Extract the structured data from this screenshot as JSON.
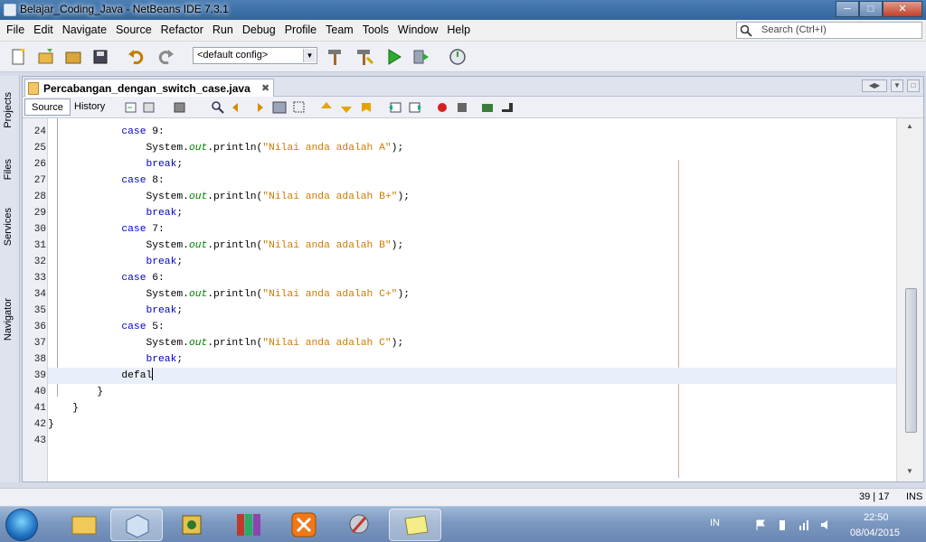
{
  "window": {
    "title": "Belajar_Coding_Java - NetBeans IDE 7.3.1",
    "min_label": "─",
    "max_label": "□",
    "close_label": "✕"
  },
  "menu": [
    "File",
    "Edit",
    "Navigate",
    "Source",
    "Refactor",
    "Run",
    "Debug",
    "Profile",
    "Team",
    "Tools",
    "Window",
    "Help"
  ],
  "search": {
    "placeholder": "Search (Ctrl+I)"
  },
  "toolbar": {
    "config": "<default config>"
  },
  "dock": {
    "tabs": [
      "Projects",
      "Files",
      "Services",
      "Navigator"
    ]
  },
  "editor": {
    "file_tab": "Percabangan_dengan_switch_case.java",
    "close_glyph": "✖",
    "source_label": "Source",
    "history_label": "History",
    "lines": [
      {
        "n": "24",
        "parts": [
          {
            "t": "            "
          },
          {
            "t": "case",
            "c": "kw"
          },
          {
            "t": " 9:"
          }
        ]
      },
      {
        "n": "25",
        "parts": [
          {
            "t": "                System."
          },
          {
            "t": "out",
            "c": "fld"
          },
          {
            "t": ".println("
          },
          {
            "t": "\"Nilai anda adalah A\"",
            "c": "str"
          },
          {
            "t": ");"
          }
        ]
      },
      {
        "n": "26",
        "parts": [
          {
            "t": "                "
          },
          {
            "t": "break",
            "c": "kw"
          },
          {
            "t": ";"
          }
        ]
      },
      {
        "n": "27",
        "parts": [
          {
            "t": "            "
          },
          {
            "t": "case",
            "c": "kw"
          },
          {
            "t": " 8:"
          }
        ]
      },
      {
        "n": "28",
        "parts": [
          {
            "t": "                System."
          },
          {
            "t": "out",
            "c": "fld"
          },
          {
            "t": ".println("
          },
          {
            "t": "\"Nilai anda adalah B+\"",
            "c": "str"
          },
          {
            "t": ");"
          }
        ]
      },
      {
        "n": "29",
        "parts": [
          {
            "t": "                "
          },
          {
            "t": "break",
            "c": "kw"
          },
          {
            "t": ";"
          }
        ]
      },
      {
        "n": "30",
        "parts": [
          {
            "t": "            "
          },
          {
            "t": "case",
            "c": "kw"
          },
          {
            "t": " 7:"
          }
        ]
      },
      {
        "n": "31",
        "parts": [
          {
            "t": "                System."
          },
          {
            "t": "out",
            "c": "fld"
          },
          {
            "t": ".println("
          },
          {
            "t": "\"Nilai anda adalah B\"",
            "c": "str"
          },
          {
            "t": ");"
          }
        ]
      },
      {
        "n": "32",
        "parts": [
          {
            "t": "                "
          },
          {
            "t": "break",
            "c": "kw"
          },
          {
            "t": ";"
          }
        ]
      },
      {
        "n": "33",
        "parts": [
          {
            "t": "            "
          },
          {
            "t": "case",
            "c": "kw"
          },
          {
            "t": " 6:"
          }
        ]
      },
      {
        "n": "34",
        "parts": [
          {
            "t": "                System."
          },
          {
            "t": "out",
            "c": "fld"
          },
          {
            "t": ".println("
          },
          {
            "t": "\"Nilai anda adalah C+\"",
            "c": "str"
          },
          {
            "t": ");"
          }
        ]
      },
      {
        "n": "35",
        "parts": [
          {
            "t": "                "
          },
          {
            "t": "break",
            "c": "kw"
          },
          {
            "t": ";"
          }
        ]
      },
      {
        "n": "36",
        "parts": [
          {
            "t": "            "
          },
          {
            "t": "case",
            "c": "kw"
          },
          {
            "t": " 5:"
          }
        ]
      },
      {
        "n": "37",
        "parts": [
          {
            "t": "                System."
          },
          {
            "t": "out",
            "c": "fld"
          },
          {
            "t": ".println("
          },
          {
            "t": "\"Nilai anda adalah C\"",
            "c": "str"
          },
          {
            "t": ");"
          }
        ]
      },
      {
        "n": "38",
        "parts": [
          {
            "t": "                "
          },
          {
            "t": "break",
            "c": "kw"
          },
          {
            "t": ";"
          }
        ]
      },
      {
        "n": "39",
        "parts": [
          {
            "t": "            defal"
          }
        ],
        "current": true
      },
      {
        "n": "40",
        "parts": [
          {
            "t": "        }"
          }
        ]
      },
      {
        "n": "41",
        "parts": [
          {
            "t": "    }"
          }
        ]
      },
      {
        "n": "42",
        "parts": [
          {
            "t": "}"
          }
        ]
      },
      {
        "n": "43",
        "parts": [
          {
            "t": ""
          }
        ]
      }
    ]
  },
  "status": {
    "position": "39 | 17",
    "mode": "INS"
  },
  "taskbar": {
    "lang": "IN",
    "time": "22:50",
    "date": "08/04/2015"
  },
  "colors": {
    "keyword": "#0000c8",
    "string": "#ce7b00",
    "field": "#008000"
  }
}
